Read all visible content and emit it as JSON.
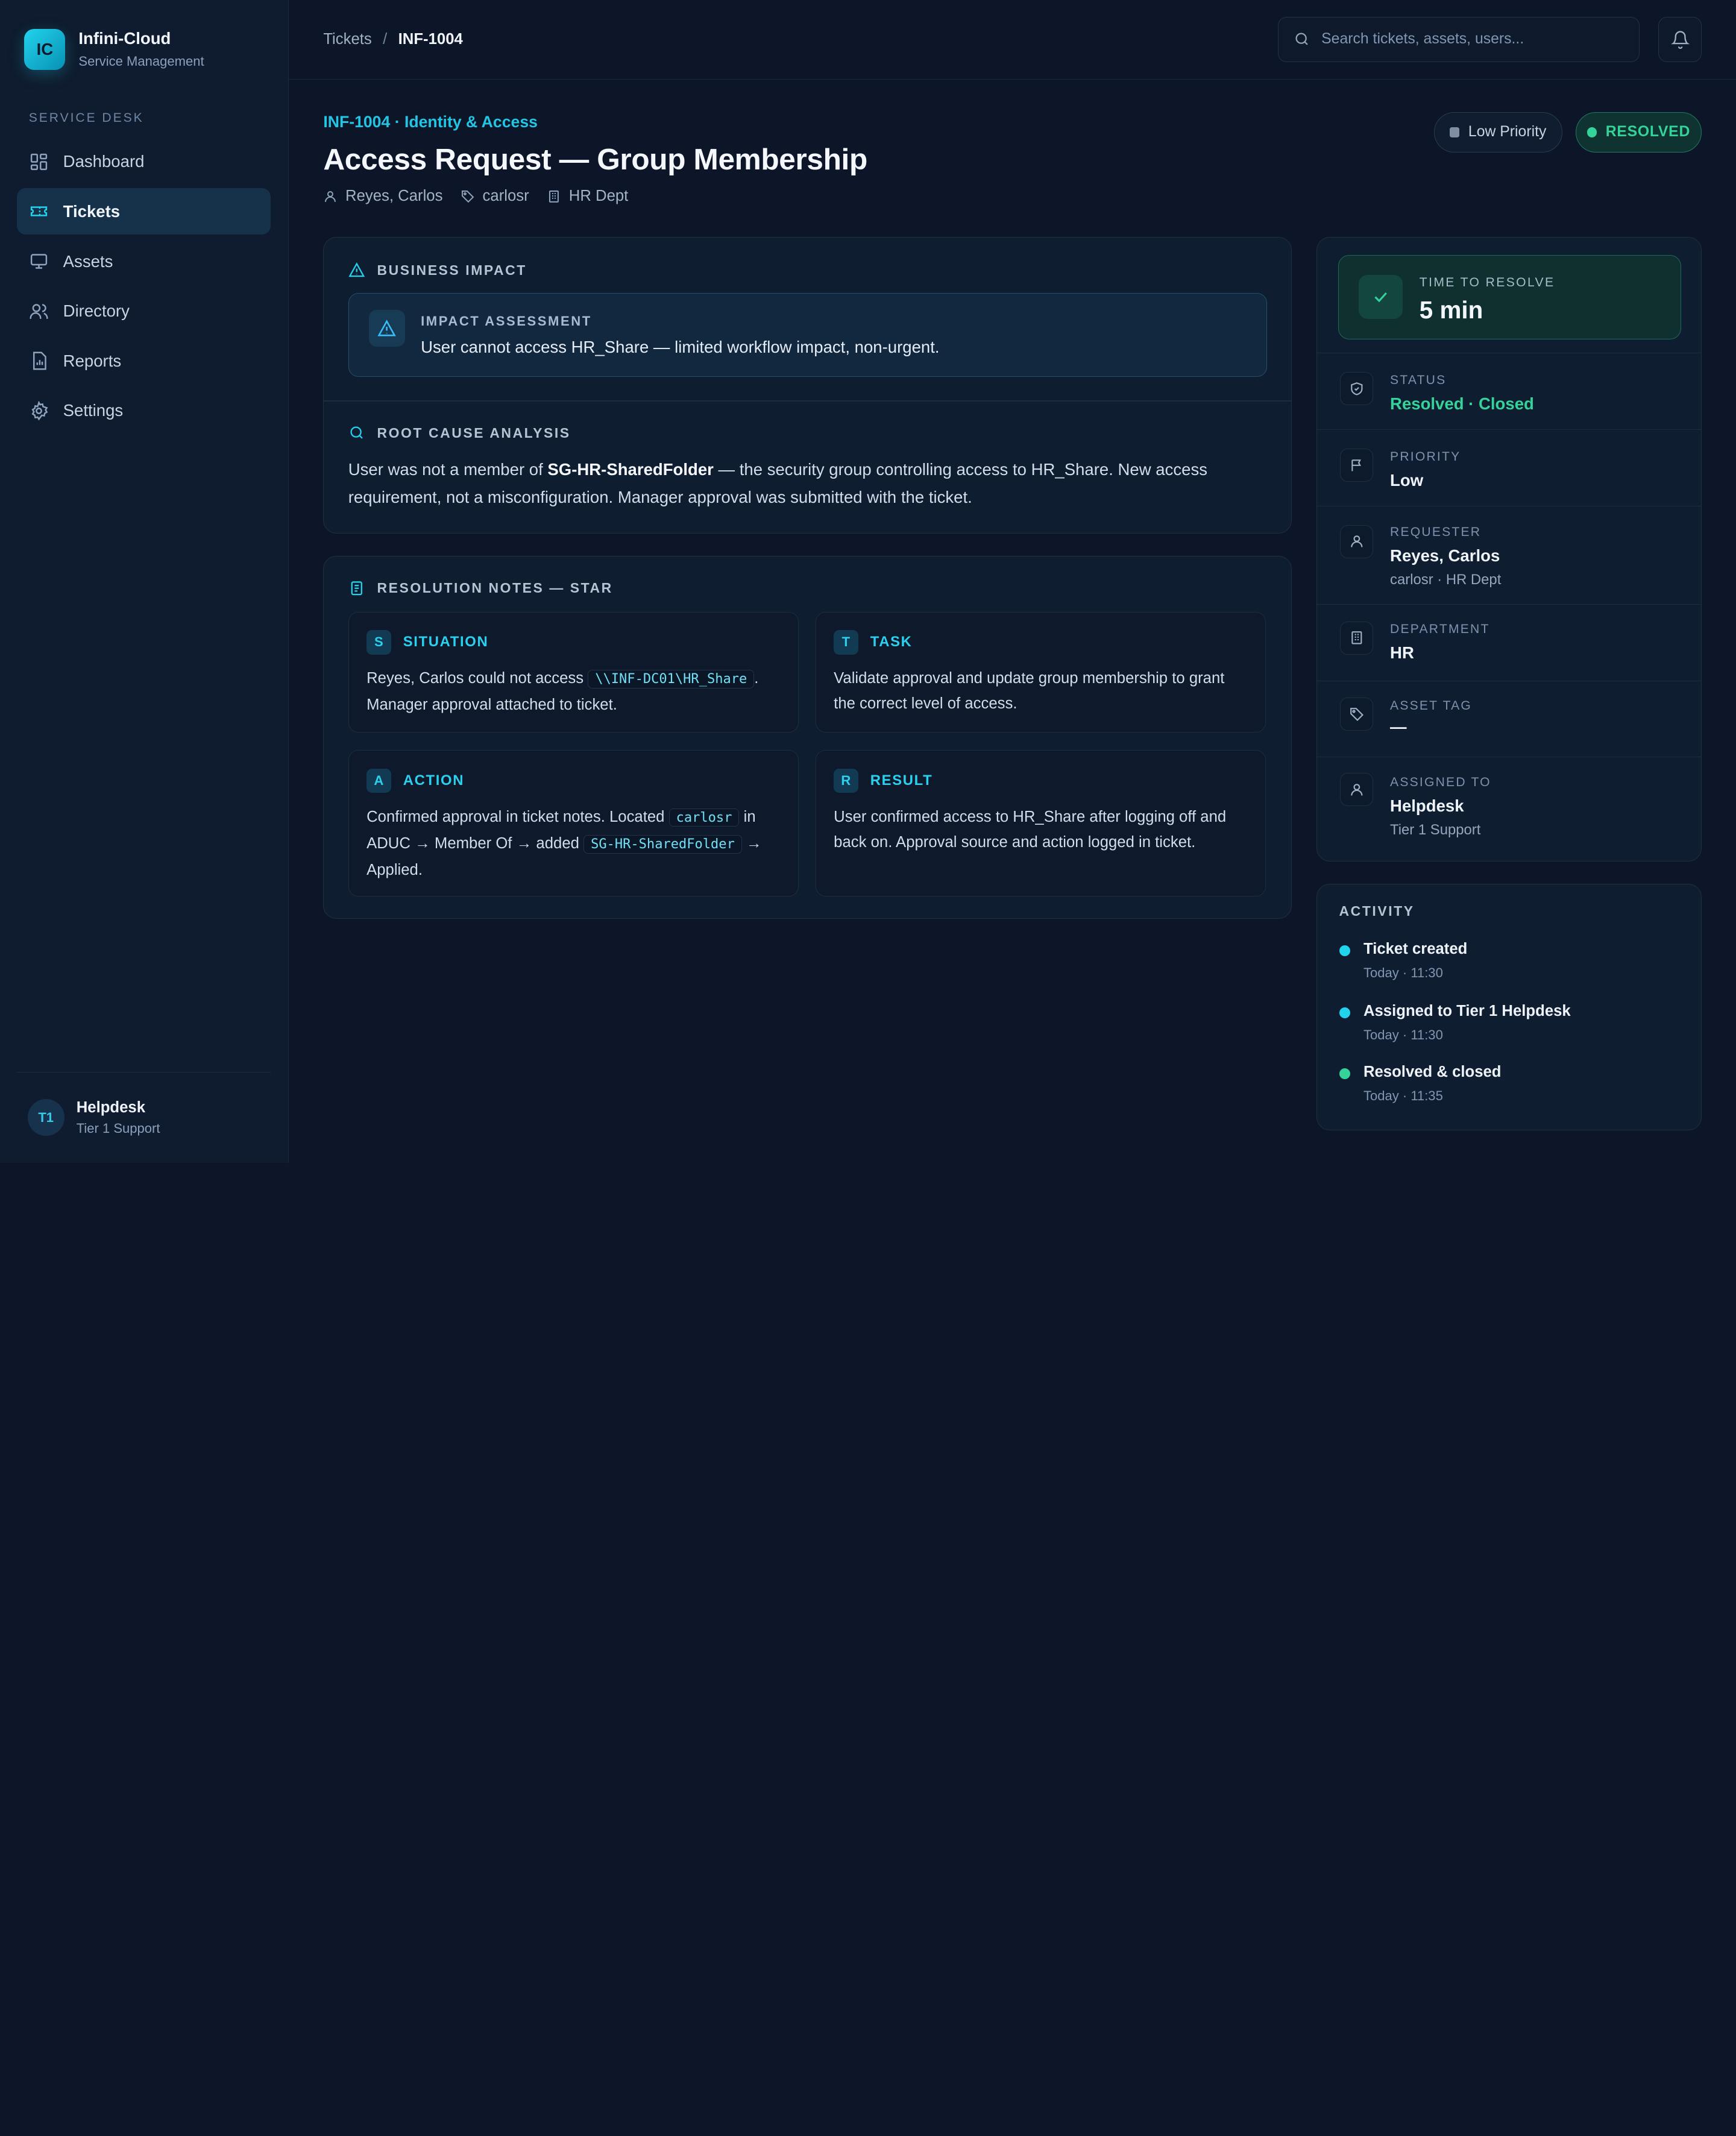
{
  "brand": {
    "logo": "IC",
    "name": "Infini-Cloud",
    "subtitle": "Service Management"
  },
  "sidebar": {
    "section": "SERVICE DESK",
    "items": [
      {
        "label": "Dashboard",
        "icon": "dashboard-icon",
        "active": false
      },
      {
        "label": "Tickets",
        "icon": "ticket-icon",
        "active": true
      },
      {
        "label": "Assets",
        "icon": "monitor-icon",
        "active": false
      },
      {
        "label": "Directory",
        "icon": "users-icon",
        "active": false
      },
      {
        "label": "Reports",
        "icon": "report-icon",
        "active": false
      },
      {
        "label": "Settings",
        "icon": "gear-icon",
        "active": false
      }
    ],
    "user": {
      "initials": "T1",
      "name": "Helpdesk",
      "role": "Tier 1 Support"
    }
  },
  "topbar": {
    "breadcrumb_root": "Tickets",
    "breadcrumb_sep": "/",
    "breadcrumb_current": "INF-1004",
    "search_placeholder": "Search tickets, assets, users..."
  },
  "ticket": {
    "kicker": "INF-1004 · Identity & Access",
    "title": "Access Request — Group Membership",
    "requester": "Reyes, Carlos",
    "username": "carlosr",
    "dept": "HR Dept",
    "priority_pill": "Low Priority",
    "status_pill": "RESOLVED"
  },
  "impact": {
    "heading": "BUSINESS IMPACT",
    "box_label": "IMPACT ASSESSMENT",
    "box_text": "User cannot access HR_Share — limited workflow impact, non-urgent."
  },
  "rca": {
    "heading": "ROOT CAUSE ANALYSIS",
    "pre": "User was not a member of ",
    "bold": "SG-HR-SharedFolder",
    "post": " — the security group controlling access to HR_Share. New access requirement, not a misconfiguration. Manager approval was submitted with the ticket."
  },
  "star": {
    "heading": "RESOLUTION NOTES — STAR",
    "situation": {
      "letter": "S",
      "title": "SITUATION",
      "pre": "Reyes, Carlos could not access ",
      "code": "\\\\INF-DC01\\HR_Share",
      "post": ". Manager approval attached to ticket."
    },
    "task": {
      "letter": "T",
      "title": "TASK",
      "text": "Validate approval and update group membership to grant the correct level of access."
    },
    "action": {
      "letter": "A",
      "title": "ACTION",
      "pre": "Confirmed approval in ticket notes. Located ",
      "code1": "carlosr",
      "mid": " in ADUC → Member Of → added ",
      "code2": "SG-HR-SharedFolder",
      "post": " → Applied."
    },
    "result": {
      "letter": "R",
      "title": "RESULT",
      "text": "User confirmed access to HR_Share after logging off and back on. Approval source and action logged in ticket."
    }
  },
  "details": {
    "ttr_label": "TIME TO RESOLVE",
    "ttr_value": "5 min",
    "status_label": "STATUS",
    "status_value": "Resolved · Closed",
    "priority_label": "PRIORITY",
    "priority_value": "Low",
    "requester_label": "REQUESTER",
    "requester_value": "Reyes, Carlos",
    "requester_sub": "carlosr · HR Dept",
    "department_label": "DEPARTMENT",
    "department_value": "HR",
    "asset_label": "ASSET TAG",
    "asset_value": "—",
    "assigned_label": "ASSIGNED TO",
    "assigned_value": "Helpdesk",
    "assigned_sub": "Tier 1 Support"
  },
  "activity": {
    "heading": "ACTIVITY",
    "items": [
      {
        "title": "Ticket created",
        "time": "Today · 11:30"
      },
      {
        "title": "Assigned to Tier 1 Helpdesk",
        "time": "Today · 11:30"
      },
      {
        "title": "Resolved & closed",
        "time": "Today · 11:35"
      }
    ]
  },
  "colors": {
    "accent": "#22d3ee",
    "success": "#34d399",
    "background": "#0c1628"
  }
}
